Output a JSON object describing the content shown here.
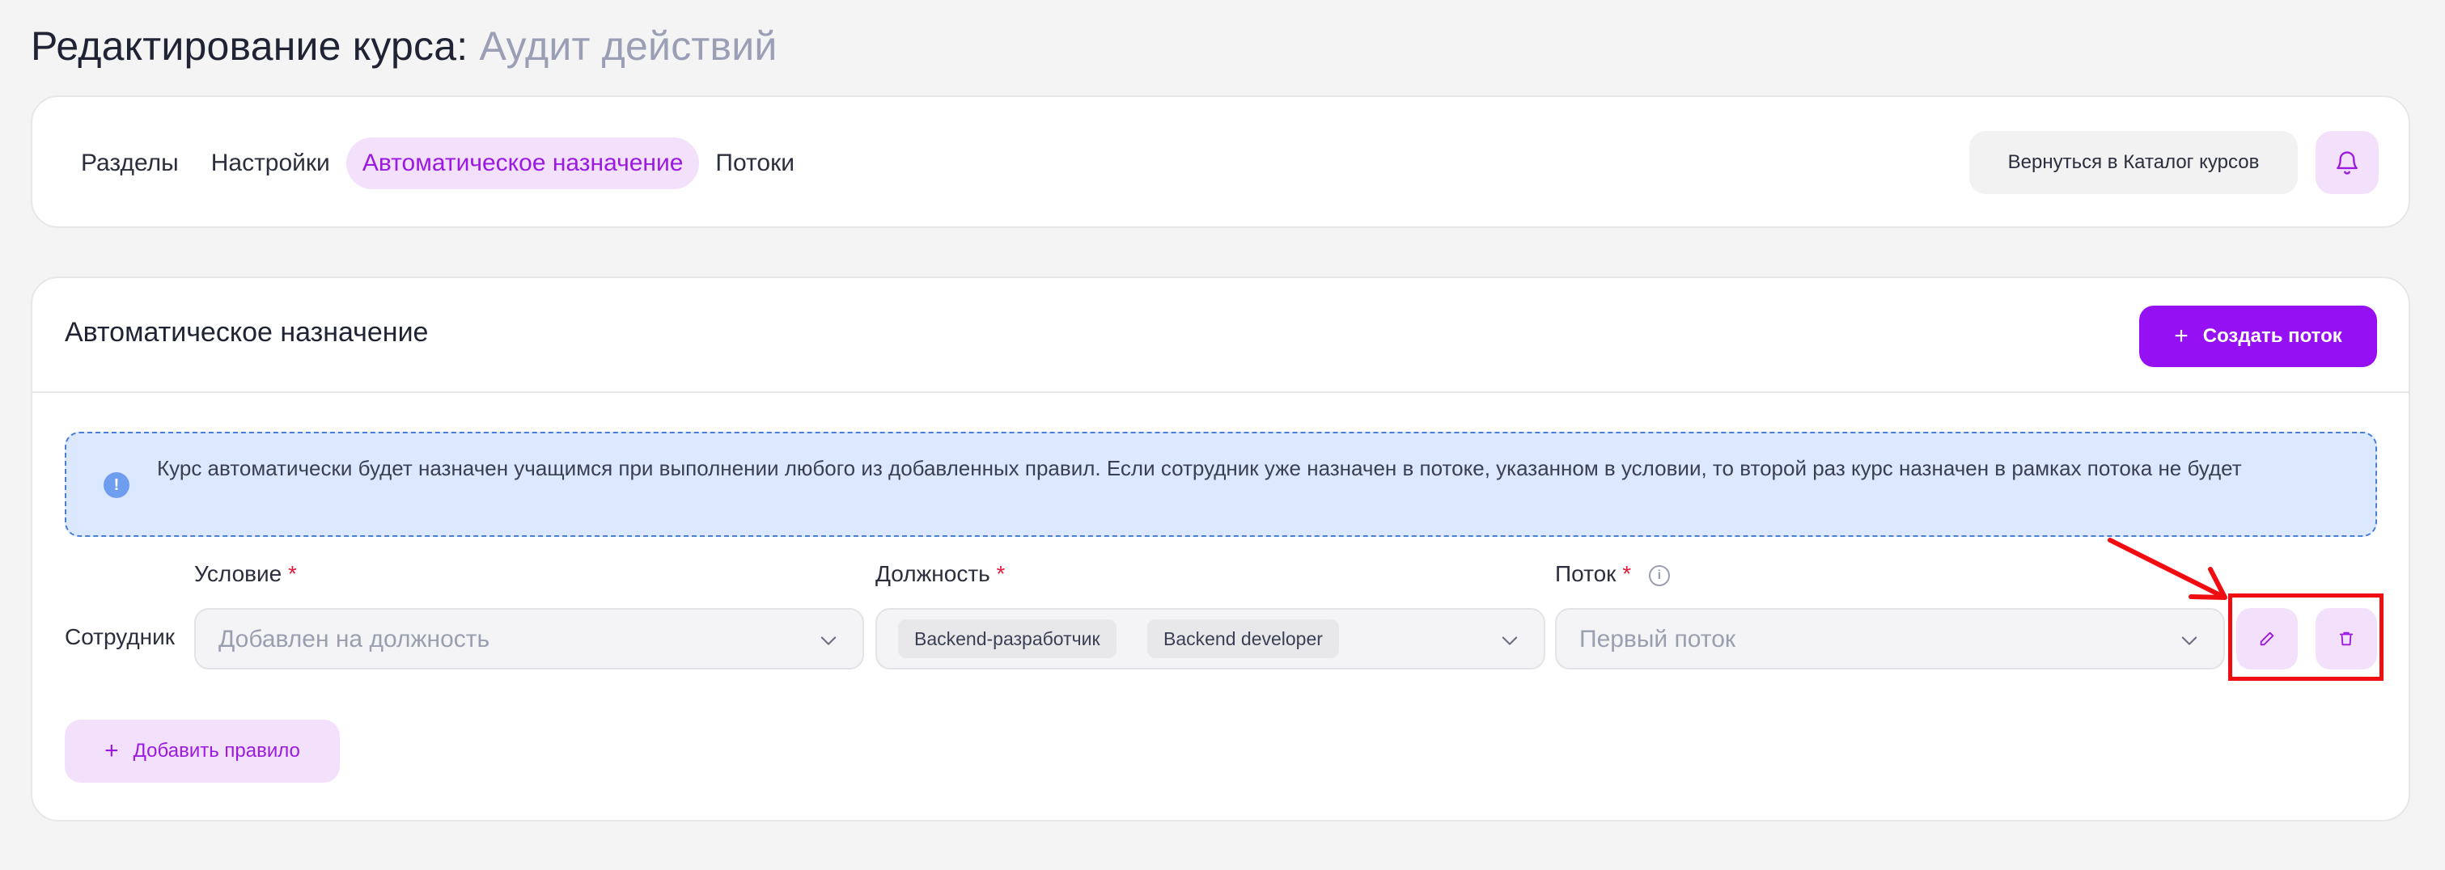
{
  "page": {
    "title_prefix": "Редактирование курса:",
    "course_name": "Аудит действий"
  },
  "tabs": [
    {
      "label": "Разделы",
      "active": false
    },
    {
      "label": "Настройки",
      "active": false
    },
    {
      "label": "Автоматическое назначение",
      "active": true
    },
    {
      "label": "Потоки",
      "active": false
    }
  ],
  "header_actions": {
    "back_label": "Вернуться в Каталог курсов",
    "bell_icon": "bell-icon"
  },
  "section": {
    "title": "Автоматическое назначение",
    "create_label": "Создать поток"
  },
  "info": {
    "text": "Курс автоматически будет назначен учащимся при выполнении любого из добавленных правил. Если сотрудник уже назначен в потоке, указанном в условии, то второй раз курс назначен в рамках потока не будет"
  },
  "rule": {
    "row_label": "Сотрудник",
    "condition": {
      "label": "Условие",
      "required_mark": "*",
      "value": "Добавлен на должность"
    },
    "position": {
      "label": "Должность",
      "required_mark": "*",
      "chips": [
        "Backend-разработчик",
        "Backend developer"
      ]
    },
    "stream": {
      "label": "Поток",
      "required_mark": "*",
      "value": "Первый поток",
      "hint": "i"
    },
    "edit_icon": "pencil-icon",
    "delete_icon": "trash-icon"
  },
  "add_rule_label": "Добавить правило",
  "colors": {
    "accent": "#9510f2",
    "accent_soft": "#f3e1fb",
    "info_bg": "#dbe8fd",
    "annotation": "#ef0d12"
  }
}
